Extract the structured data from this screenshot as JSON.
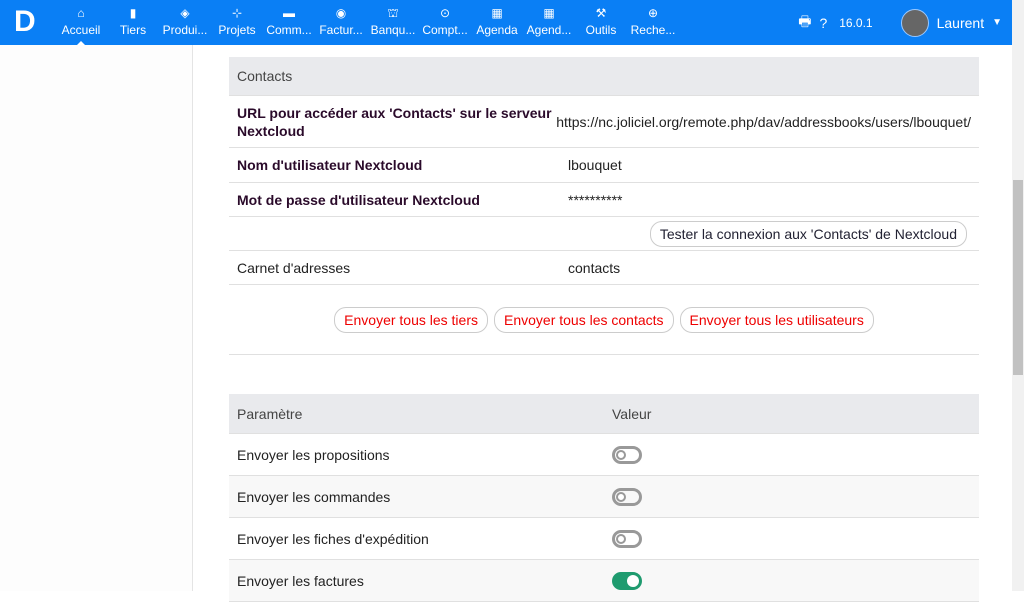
{
  "nav": {
    "items": [
      {
        "label": "Accueil",
        "icon": "home-icon",
        "glyph": "⌂"
      },
      {
        "label": "Tiers",
        "icon": "building-icon",
        "glyph": "▮"
      },
      {
        "label": "Produi...",
        "icon": "cube-icon",
        "glyph": "◈"
      },
      {
        "label": "Projets",
        "icon": "project-icon",
        "glyph": "⊹"
      },
      {
        "label": "Comm...",
        "icon": "briefcase-icon",
        "glyph": "▬"
      },
      {
        "label": "Factur...",
        "icon": "coins-icon",
        "glyph": "◉"
      },
      {
        "label": "Banqu...",
        "icon": "bank-icon",
        "glyph": "⛫"
      },
      {
        "label": "Compt...",
        "icon": "search-dollar-icon",
        "glyph": "⊙"
      },
      {
        "label": "Agenda",
        "icon": "calendar-icon",
        "glyph": "▦"
      },
      {
        "label": "Agend...",
        "icon": "calendar-icon",
        "glyph": "▦"
      },
      {
        "label": "Outils",
        "icon": "wrench-icon",
        "glyph": "⚒"
      },
      {
        "label": "Reche...",
        "icon": "search-plus-icon",
        "glyph": "⊕"
      }
    ],
    "version": "16.0.1",
    "user": "Laurent"
  },
  "contacts": {
    "header": "Contacts",
    "url_label": "URL pour accéder aux 'Contacts' sur le serveur Nextcloud",
    "url_value": "https://nc.joliciel.org/remote.php/dav/addressbooks/users/lbouquet/",
    "user_label": "Nom d'utilisateur Nextcloud",
    "user_value": "lbouquet",
    "pass_label": "Mot de passe d'utilisateur Nextcloud",
    "pass_value": "**********",
    "test_button": "Tester la connexion aux 'Contacts' de Nextcloud",
    "book_label": "Carnet d'adresses",
    "book_value": "contacts",
    "send_buttons": [
      "Envoyer tous les tiers",
      "Envoyer tous les contacts",
      "Envoyer tous les utilisateurs"
    ]
  },
  "params": {
    "col1": "Paramètre",
    "col2": "Valeur",
    "rows": [
      {
        "label": "Envoyer les propositions",
        "on": false
      },
      {
        "label": "Envoyer les commandes",
        "on": false
      },
      {
        "label": "Envoyer les fiches d'expédition",
        "on": false
      },
      {
        "label": "Envoyer les factures",
        "on": true
      }
    ]
  },
  "colors": {
    "nav": "#0a7ff5",
    "toggle_on": "#1f9b6f",
    "send_button_text": "#ee0000"
  }
}
